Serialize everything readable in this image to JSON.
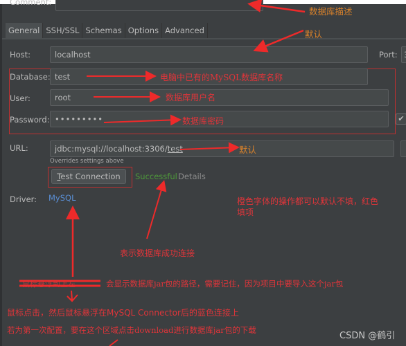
{
  "dialog": {
    "comment_label": "Comment:",
    "comment_value": "",
    "tabs": [
      {
        "label": "General",
        "active": true
      },
      {
        "label": "SSH/SSL",
        "active": false
      },
      {
        "label": "Schemas",
        "active": false
      },
      {
        "label": "Options",
        "active": false
      },
      {
        "label": "Advanced",
        "active": false
      }
    ],
    "host_label": "Host:",
    "host_value": "localhost",
    "port_label": "Port:",
    "port_value": "3",
    "database_label": "Database:",
    "database_value": "test",
    "user_label": "User:",
    "user_value": "root",
    "password_label": "Password:",
    "password_value": "•••••••••",
    "remember_password_checked": true,
    "checkbox_glyph": "✔",
    "url_label": "URL:",
    "url_prefix": "jdbc:mysql://localhost:3306/",
    "url_db": "test",
    "url_hint": "Overrides settings above",
    "test_connection_label": "Test Connection",
    "test_connection_mnemonic": "T",
    "test_connection_rest": "est Connection",
    "status_text": "Successful",
    "status_color": "#4e9a3a",
    "details_label": "Details",
    "driver_label": "Driver:",
    "driver_value": "MySQL",
    "driver_link_color": "#5a8fd6"
  },
  "annotations": {
    "comment": "数据库描述",
    "host_default": "默认",
    "database": "电脑中已有的MySQL数据库名称",
    "user": "数据库用户名",
    "password": "数据库密码",
    "url_default": "默认",
    "note_orange_line1": "橙色字体的操作都可以默认不填，红色",
    "note_orange_line2": "填项",
    "success": "表示数据库成功连接",
    "jar_path": "会显示数据库jar包的路径，需要记住，因为项目中要导入这个jar包",
    "hover": "鼠标点击，然后鼠标悬浮在MySQL Connector后的蓝色连接上",
    "download": "若为第一次配置，要在这个区域点击download进行数据库jar包的下载",
    "strikethrough": "鼠标悬浮到上左"
  },
  "watermark": "CSDN @鹤引"
}
